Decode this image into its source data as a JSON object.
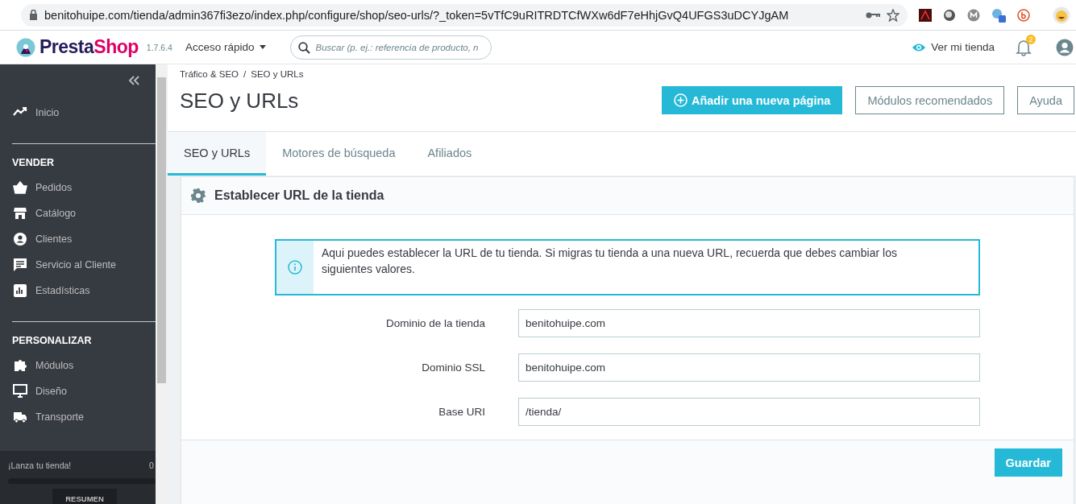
{
  "browser": {
    "url": "benitohuipe.com/tienda/admin367fi3ezo/index.php/configure/shop/seo-urls/?_token=5vTfC9uRITRDTCfWXw6dF7eHhjGvQ4UFGS3uDCYJgAM"
  },
  "header": {
    "logo_first": "Presta",
    "logo_second": "Shop",
    "version": "1.7.6.4",
    "quick_access": "Acceso rápido",
    "search_placeholder": "Buscar (p. ej.: referencia de producto, n",
    "view_store": "Ver mi tienda",
    "notification_count": "2"
  },
  "sidebar": {
    "sections": [
      {
        "items": [
          {
            "label": "Inicio"
          }
        ]
      },
      {
        "heading": "VENDER",
        "items": [
          {
            "label": "Pedidos"
          },
          {
            "label": "Catálogo"
          },
          {
            "label": "Clientes"
          },
          {
            "label": "Servicio al Cliente"
          },
          {
            "label": "Estadísticas"
          }
        ]
      },
      {
        "heading": "PERSONALIZAR",
        "items": [
          {
            "label": "Módulos"
          },
          {
            "label": "Diseño"
          },
          {
            "label": "Transporte"
          }
        ]
      }
    ],
    "launch": {
      "text": "¡Lanza tu tienda!",
      "percent": "0",
      "level": 0
    },
    "summary_button": "RESUMEN"
  },
  "page": {
    "breadcrumb": [
      "Tráfico & SEO",
      "SEO y URLs"
    ],
    "breadcrumb_separator": "/",
    "title": "SEO y URLs",
    "buttons": [
      {
        "label": "Añadir una nueva página",
        "kind": "primary"
      },
      {
        "label": "Módulos recomendados",
        "kind": "outline"
      },
      {
        "label": "Ayuda",
        "kind": "outline"
      }
    ]
  },
  "tabs": [
    {
      "label": "SEO y URLs",
      "selected": true
    },
    {
      "label": "Motores de búsqueda",
      "selected": false
    },
    {
      "label": "Afiliados",
      "selected": false
    }
  ],
  "panel": {
    "title": "Establecer URL de la tienda",
    "alert": "Aqui puedes establecer la URL de tu tienda. Si migras tu tienda a una nueva URL, recuerda que debes cambiar los siguientes valores.",
    "fields": [
      {
        "label": "Dominio de la tienda",
        "value": "benitohuipe.com"
      },
      {
        "label": "Dominio SSL",
        "value": "benitohuipe.com"
      },
      {
        "label": "Base URI",
        "value": "/tienda/"
      }
    ],
    "save_button": "Guardar"
  }
}
